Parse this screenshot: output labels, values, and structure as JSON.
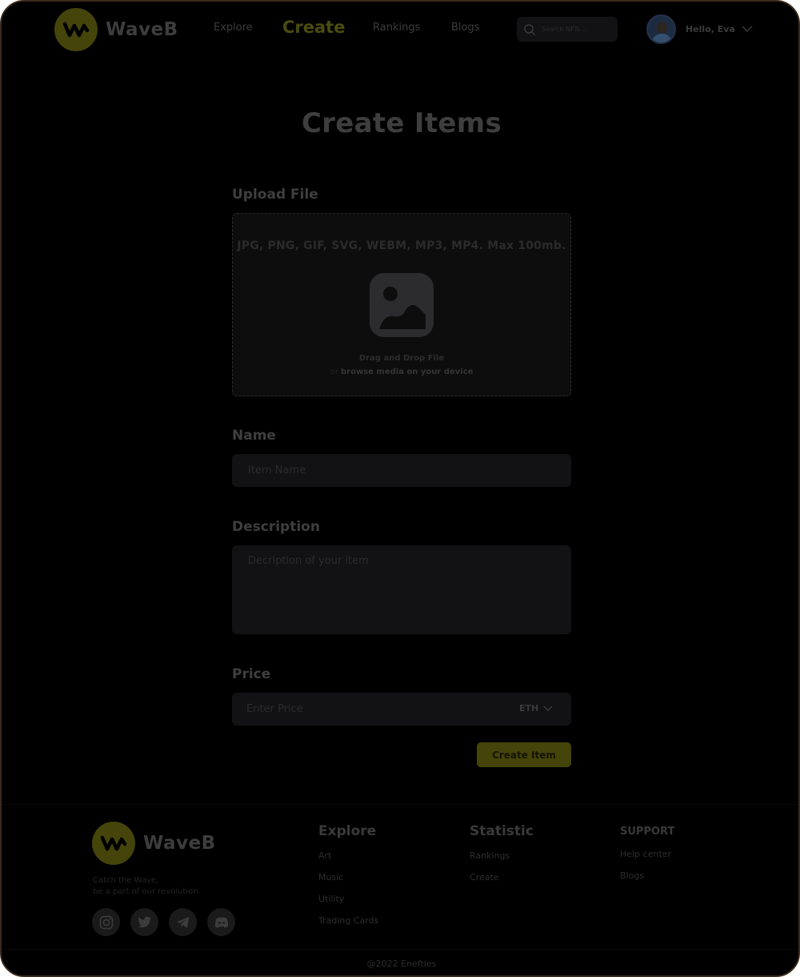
{
  "brand": {
    "name": "WaveB",
    "accent": "#45440a"
  },
  "nav": {
    "items": [
      {
        "label": "Explore",
        "active": false
      },
      {
        "label": "Create",
        "active": true
      },
      {
        "label": "Rankings",
        "active": false
      },
      {
        "label": "Blogs",
        "active": false
      }
    ]
  },
  "search": {
    "placeholder": "Search NFTs..."
  },
  "user": {
    "greeting": "Hello, Eva"
  },
  "page": {
    "title": "Create Items"
  },
  "upload": {
    "label": "Upload File",
    "formats": "JPG, PNG, GIF, SVG, WEBM, MP3, MP4. Max 100mb.",
    "drag_text": "Drag and Drop File",
    "or_text": "or",
    "browse_text": "browse media on your device"
  },
  "name_field": {
    "label": "Name",
    "placeholder": "Item Name"
  },
  "description_field": {
    "label": "Description",
    "placeholder": "Decription of your item"
  },
  "price_field": {
    "label": "Price",
    "placeholder": "Enter Price",
    "currency": "ETH"
  },
  "submit": {
    "label": "Create Item"
  },
  "footer": {
    "tagline_1": "Catch the Wave,",
    "tagline_2": "be a part of our revolution.",
    "explore": {
      "title": "Explore",
      "links": [
        "Art",
        "Music",
        "Utility",
        "Trading Cards"
      ]
    },
    "statistic": {
      "title": "Statistic",
      "links": [
        "Rankings",
        "Create"
      ]
    },
    "support": {
      "title": "SUPPORT",
      "links": [
        "Help center",
        "Blogs"
      ]
    },
    "socials": [
      "instagram-icon",
      "twitter-icon",
      "telegram-icon",
      "discord-icon"
    ],
    "copyright": "@2022 Enefties"
  }
}
